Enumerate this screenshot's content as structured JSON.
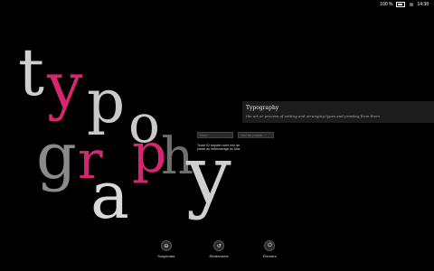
{
  "status": {
    "battery": "100 %",
    "time": "14:38"
  },
  "wordmark_letters": [
    "t",
    "y",
    "p",
    "o",
    "g",
    "r",
    "a",
    "p",
    "h",
    "y"
  ],
  "login": {
    "field1_placeholder": "Nom",
    "field2_placeholder": "Mot de passe",
    "touchid_text": "Touch ID requiert votre mot de passe au redémarrage du Mac"
  },
  "panel": {
    "title": "Typography",
    "desc": "the art or process of setting and arranging types and printing from them"
  },
  "power": [
    {
      "label": "Suspendre",
      "icon": "sleep-icon",
      "glyph": "⊖"
    },
    {
      "label": "Redémarrer",
      "icon": "restart-icon",
      "glyph": "↺"
    },
    {
      "label": "Éteindre",
      "icon": "power-icon",
      "glyph": "⏻"
    }
  ]
}
